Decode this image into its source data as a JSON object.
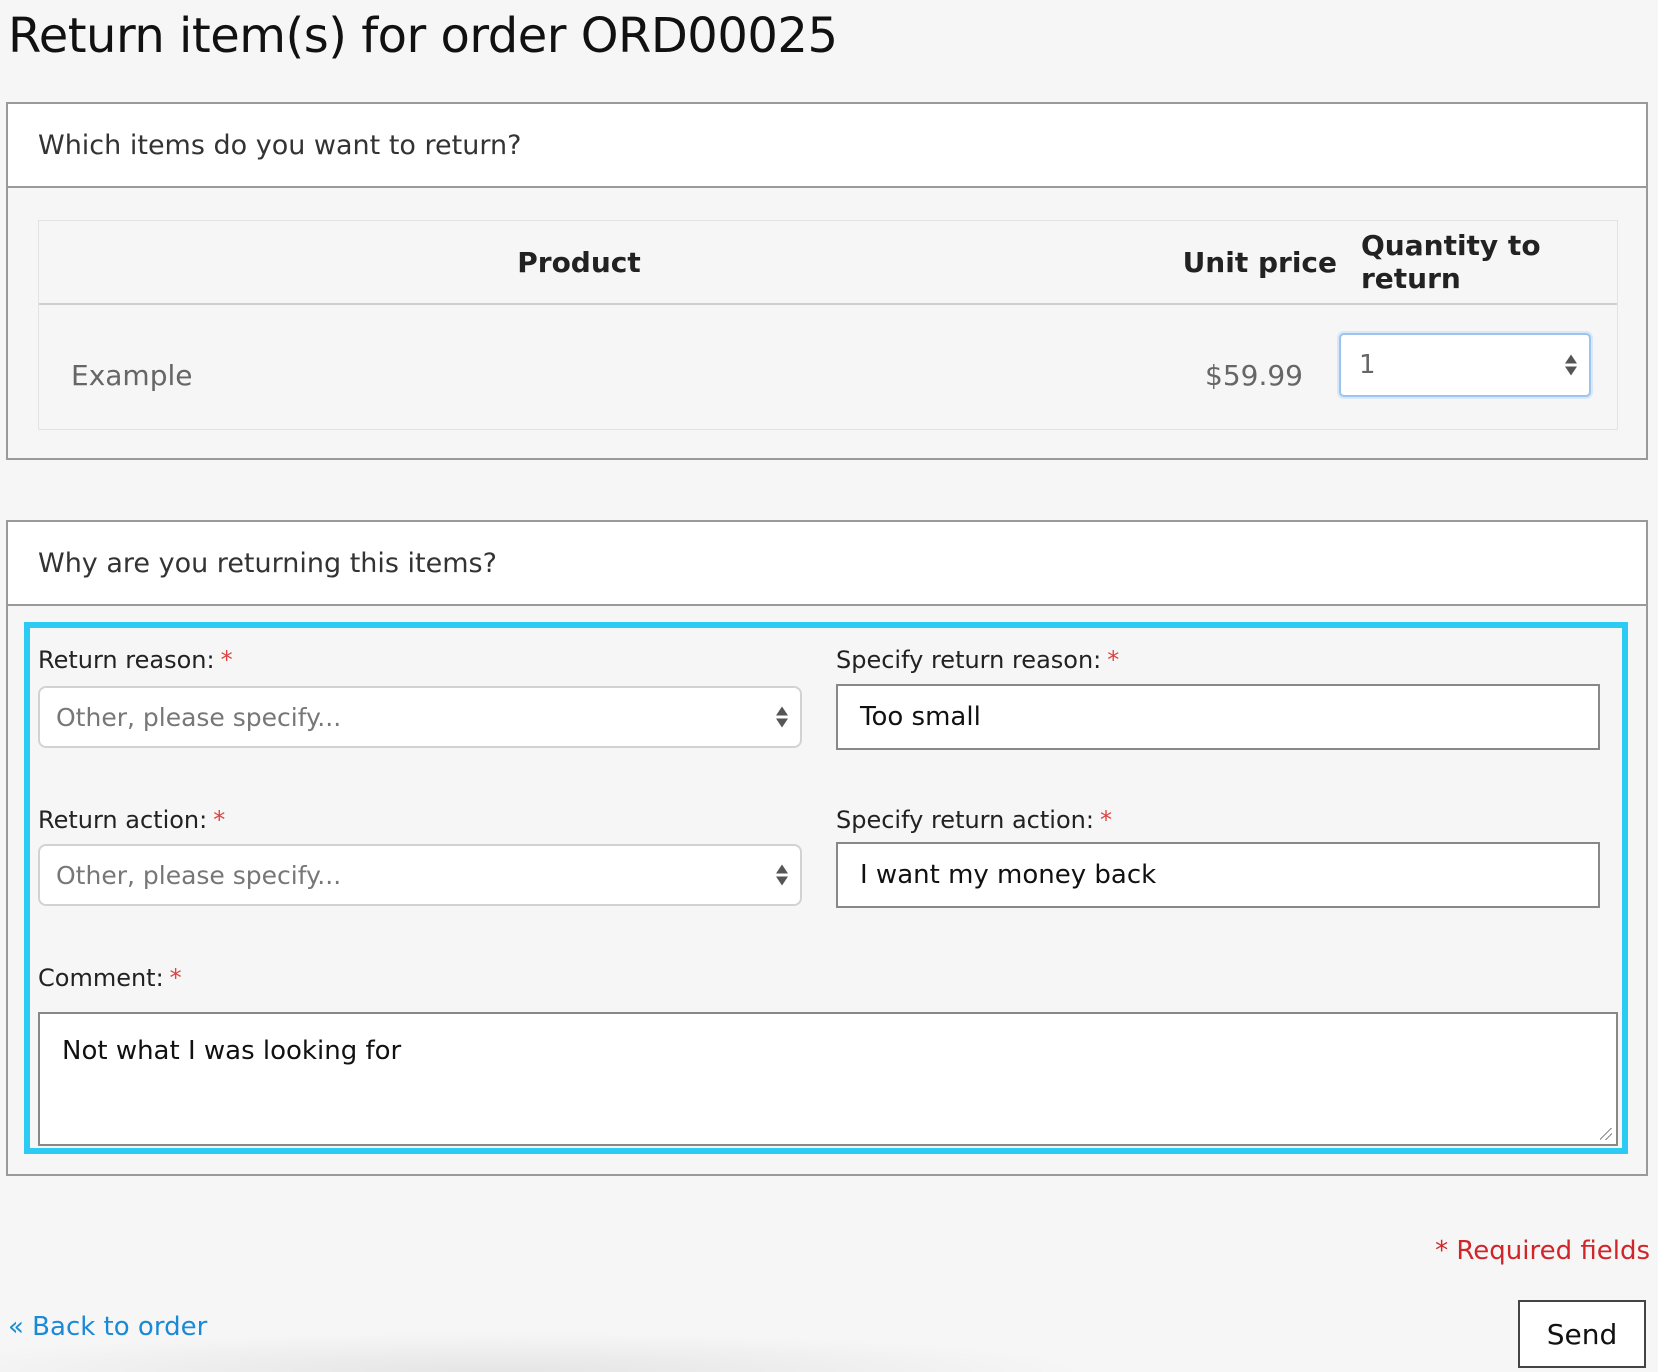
{
  "page": {
    "title": "Return item(s) for order ORD00025"
  },
  "items_section": {
    "header": "Which items do you want to return?",
    "columns": {
      "product": "Product",
      "unit_price": "Unit price",
      "quantity": "Quantity to return"
    },
    "rows": [
      {
        "product": "Example",
        "unit_price": "$59.99",
        "quantity": "1"
      }
    ]
  },
  "reason_section": {
    "header": "Why are you returning this items?",
    "return_reason": {
      "label": "Return reason:",
      "value": "Other, please specify..."
    },
    "specify_reason": {
      "label": "Specify return reason:",
      "value": "Too small"
    },
    "return_action": {
      "label": "Return action:",
      "value": "Other, please specify..."
    },
    "specify_action": {
      "label": "Specify return action:",
      "value": "I want my money back"
    },
    "comment": {
      "label": "Comment:",
      "value": "Not what I was looking for"
    },
    "required_marker": "*"
  },
  "footer": {
    "required_note": "* Required fields",
    "back_link": "« Back to order",
    "send_label": "Send"
  },
  "colors": {
    "highlight": "#2ccbf4",
    "required": "#d0262a",
    "link": "#1b8ad6"
  }
}
